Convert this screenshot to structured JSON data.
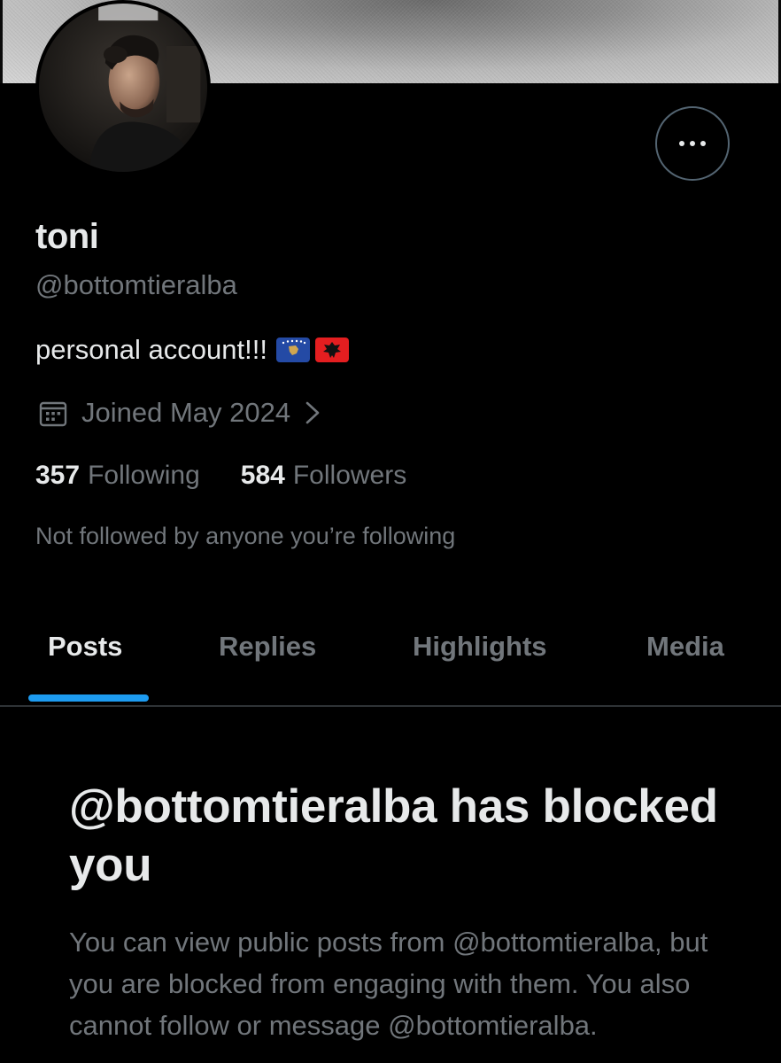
{
  "profile": {
    "display_name": "toni",
    "handle": "@bottomtieralba",
    "bio": "personal account!!!",
    "bio_flags": [
      "kosovo-flag",
      "albania-flag"
    ],
    "joined": "Joined May 2024",
    "following_count": "357",
    "following_label": "Following",
    "followers_count": "584",
    "followers_label": "Followers",
    "not_followed_text": "Not followed by anyone you’re following"
  },
  "tabs": [
    {
      "label": "Posts",
      "active": true
    },
    {
      "label": "Replies",
      "active": false
    },
    {
      "label": "Highlights",
      "active": false
    },
    {
      "label": "Media",
      "active": false
    }
  ],
  "blocked": {
    "title": "@bottomtieralba has blocked you",
    "body": "You can view public posts from @bottomtieralba, but you are blocked from engaging with them. You also cannot follow or message @bottomtieralba."
  },
  "icons": {
    "more": "more-horizontal-icon",
    "calendar": "calendar-icon",
    "chevron": "chevron-right-icon"
  },
  "colors": {
    "background": "#000000",
    "primary_text": "#e7e9ea",
    "secondary_text": "#71767b",
    "accent": "#1d9bf0",
    "divider": "#2f3336"
  }
}
